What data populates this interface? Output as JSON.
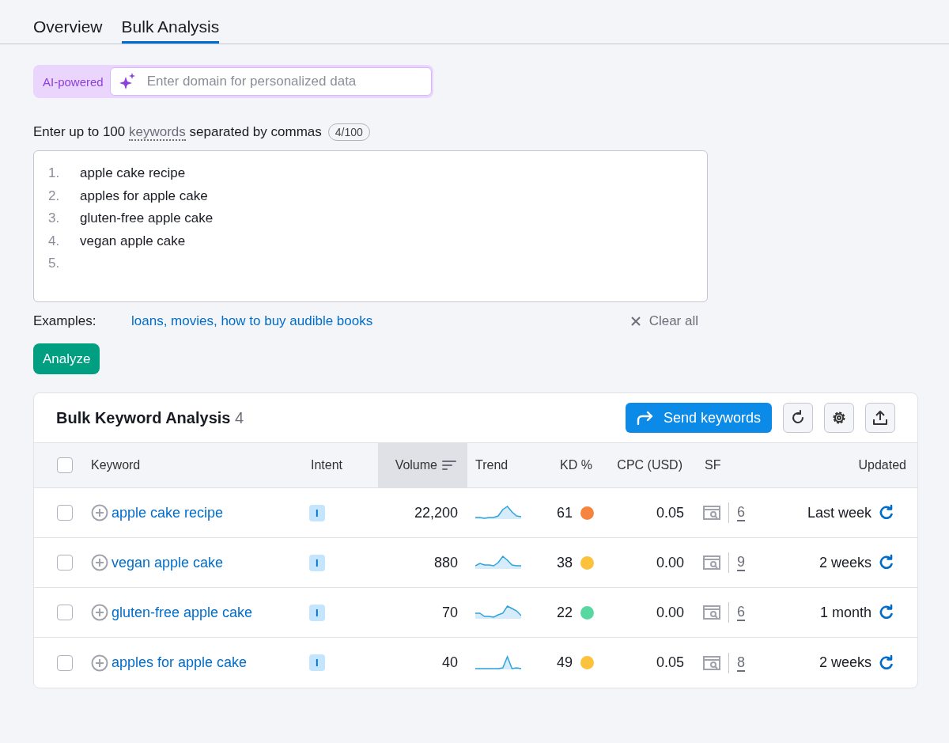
{
  "tabs": [
    {
      "label": "Overview",
      "selected": false
    },
    {
      "label": "Bulk Analysis",
      "selected": true
    }
  ],
  "ai_domain": {
    "badge": "AI-powered",
    "placeholder": "Enter domain for personalized data"
  },
  "keywords_input": {
    "label_before": "Enter up to 100",
    "label_link": "keywords",
    "label_after": "separated by commas",
    "count": "4/100",
    "lines": [
      {
        "number": "1.",
        "text": "apple cake recipe"
      },
      {
        "number": "2.",
        "text": "apples for apple cake"
      },
      {
        "number": "3.",
        "text": "gluten-free apple cake"
      },
      {
        "number": "4.",
        "text": "vegan apple cake"
      },
      {
        "number": "5."
      }
    ]
  },
  "examples": {
    "label": "Examples:",
    "link": "loans, movies, how to buy audible books",
    "clear": "Clear all"
  },
  "analyze_button": "Analyze",
  "results": {
    "title": "Bulk Keyword Analysis",
    "count": "4",
    "send_button": "Send keywords",
    "select_all": {
      "checked": false
    },
    "columns": [
      {
        "label": "Keyword",
        "sorted": false
      },
      {
        "label": "Intent",
        "sorted": false
      },
      {
        "label": "Volume",
        "sorted": true
      },
      {
        "label": "Trend",
        "sorted": false
      },
      {
        "label": "KD %",
        "sorted": false
      },
      {
        "label": "CPC (USD)",
        "sorted": false
      },
      {
        "label": "SF",
        "sorted": false
      },
      {
        "label": "Updated",
        "sorted": false
      }
    ],
    "rows": [
      {
        "checked": false,
        "keyword": "apple cake recipe",
        "intent": "I",
        "volume": "22,200",
        "kd": "61",
        "color": "#f5843f",
        "cpc": "0.05",
        "sf": "6",
        "updated": "Last week"
      },
      {
        "checked": false,
        "keyword": "vegan apple cake",
        "intent": "I",
        "volume": "880",
        "kd": "38",
        "color": "#fcc23b",
        "cpc": "0.00",
        "sf": "9",
        "updated": "2 weeks"
      },
      {
        "checked": false,
        "keyword": "gluten-free apple cake",
        "intent": "I",
        "volume": "70",
        "kd": "22",
        "color": "#58d8a0",
        "cpc": "0.00",
        "sf": "6",
        "updated": "1 month"
      },
      {
        "checked": false,
        "keyword": "apples for apple cake",
        "intent": "I",
        "volume": "40",
        "kd": "49",
        "color": "#fcc23b",
        "cpc": "0.05",
        "sf": "8",
        "updated": "2 weeks"
      }
    ]
  }
}
